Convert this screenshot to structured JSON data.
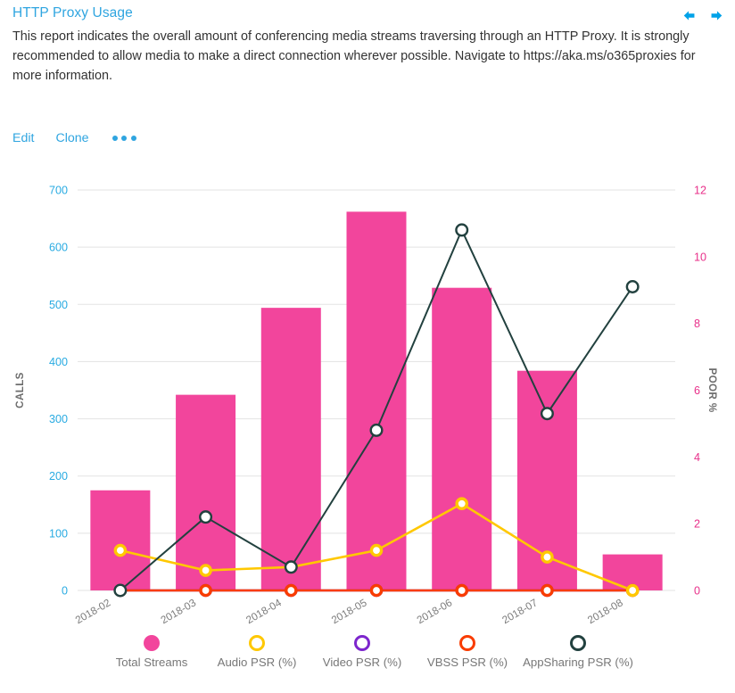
{
  "header": {
    "title": "HTTP Proxy Usage",
    "description": "This report indicates the overall amount of conferencing media streams traversing through an HTTP Proxy. It is strongly recommended to allow media to make a direct connection wherever possible. Navigate to https://aka.ms/o365proxies for more information.",
    "nav": {
      "back_icon": "arrow-left-icon",
      "forward_icon": "arrow-right-icon",
      "color": "#00a2e8"
    }
  },
  "actions": {
    "edit_label": "Edit",
    "clone_label": "Clone",
    "more_label": "•••"
  },
  "chart_data": {
    "type": "bar",
    "title": "",
    "categories": [
      "2018-02",
      "2018-03",
      "2018-04",
      "2018-05",
      "2018-06",
      "2018-07",
      "2018-08"
    ],
    "xlabel": "",
    "ylabel": "CALLS",
    "y2label": "POOR %",
    "ylim": [
      0,
      700
    ],
    "y2lim": [
      0,
      12
    ],
    "yticks": [
      0,
      100,
      200,
      300,
      400,
      500,
      600,
      700
    ],
    "y2ticks": [
      0,
      2,
      4,
      6,
      8,
      10,
      12
    ],
    "grid": true,
    "legend_position": "bottom",
    "series": [
      {
        "name": "Total Streams",
        "type": "bar",
        "axis": "left",
        "color": "#f2459c",
        "values": [
          175,
          342,
          494,
          662,
          529,
          384,
          63
        ]
      },
      {
        "name": "Audio PSR (%)",
        "type": "line",
        "axis": "right",
        "color": "#ffc800",
        "values": [
          1.2,
          0.6,
          0.7,
          1.2,
          2.6,
          1.0,
          0.0
        ]
      },
      {
        "name": "Video PSR (%)",
        "type": "line",
        "axis": "right",
        "color": "#7d26cd",
        "values": [
          0,
          0,
          0,
          0,
          0,
          0,
          0
        ]
      },
      {
        "name": "VBSS PSR (%)",
        "type": "line",
        "axis": "right",
        "color": "#f93c00",
        "values": [
          0,
          0,
          0,
          0,
          0,
          0,
          0
        ]
      },
      {
        "name": "AppSharing PSR (%)",
        "type": "line",
        "axis": "right",
        "color": "#22413f",
        "values": [
          0.0,
          2.2,
          0.7,
          4.8,
          10.8,
          5.3,
          9.1
        ]
      }
    ]
  },
  "legend": [
    {
      "label": "Total Streams",
      "color": "#f2459c",
      "filled": true
    },
    {
      "label": "Audio PSR (%)",
      "color": "#ffc800",
      "filled": false
    },
    {
      "label": "Video PSR (%)",
      "color": "#7d26cd",
      "filled": false
    },
    {
      "label": "VBSS PSR (%)",
      "color": "#f93c00",
      "filled": false
    },
    {
      "label": "AppSharing PSR (%)",
      "color": "#22413f",
      "filled": false
    }
  ]
}
